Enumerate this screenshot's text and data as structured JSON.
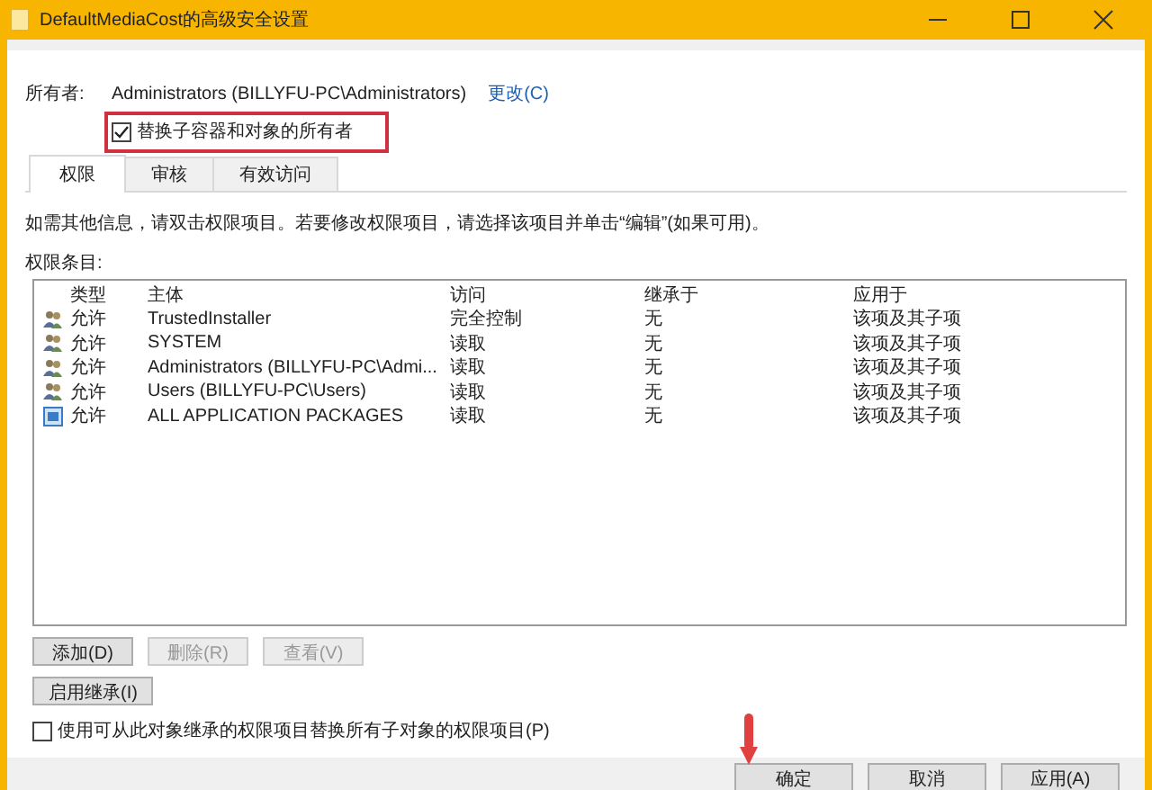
{
  "window": {
    "title": "DefaultMediaCost的高级安全设置"
  },
  "owner": {
    "label": "所有者:",
    "value": "Administrators (BILLYFU-PC\\Administrators)",
    "change_link": "更改(C)"
  },
  "replace_owner": {
    "label": "替换子容器和对象的所有者",
    "checked": true,
    "highlighted": true
  },
  "tabs": [
    {
      "label": "权限",
      "selected": true
    },
    {
      "label": "审核",
      "selected": false
    },
    {
      "label": "有效访问",
      "selected": false
    }
  ],
  "info_text": "如需其他信息，请双击权限项目。若要修改权限项目，请选择该项目并单击“编辑”(如果可用)。",
  "entries_label": "权限条目:",
  "table": {
    "columns": [
      "类型",
      "主体",
      "访问",
      "继承于",
      "应用于"
    ],
    "rows": [
      {
        "kind": "user",
        "type": "允许",
        "principal": "TrustedInstaller",
        "access": "完全控制",
        "inherited_from": "无",
        "applies_to": "该项及其子项"
      },
      {
        "kind": "user",
        "type": "允许",
        "principal": "SYSTEM",
        "access": "读取",
        "inherited_from": "无",
        "applies_to": "该项及其子项"
      },
      {
        "kind": "user",
        "type": "允许",
        "principal": "Administrators (BILLYFU-PC\\Admi...",
        "access": "读取",
        "inherited_from": "无",
        "applies_to": "该项及其子项"
      },
      {
        "kind": "user",
        "type": "允许",
        "principal": "Users (BILLYFU-PC\\Users)",
        "access": "读取",
        "inherited_from": "无",
        "applies_to": "该项及其子项"
      },
      {
        "kind": "package",
        "type": "允许",
        "principal": "ALL APPLICATION PACKAGES",
        "access": "读取",
        "inherited_from": "无",
        "applies_to": "该项及其子项"
      }
    ]
  },
  "buttons": [
    {
      "label": "添加(D)",
      "disabled": false
    },
    {
      "label": "删除(R)",
      "disabled": true
    },
    {
      "label": "查看(V)",
      "disabled": true
    }
  ],
  "inheritance_button": "启用继承(I)",
  "replace_child": {
    "label": "使用可从此对象继承的权限项目替换所有子对象的权限项目(P)",
    "checked": false
  },
  "footer_buttons": [
    {
      "label": "确定",
      "disabled": false,
      "pointed": true
    },
    {
      "label": "取消",
      "disabled": false,
      "pointed": false
    },
    {
      "label": "应用(A)",
      "disabled": false,
      "pointed": false
    }
  ]
}
